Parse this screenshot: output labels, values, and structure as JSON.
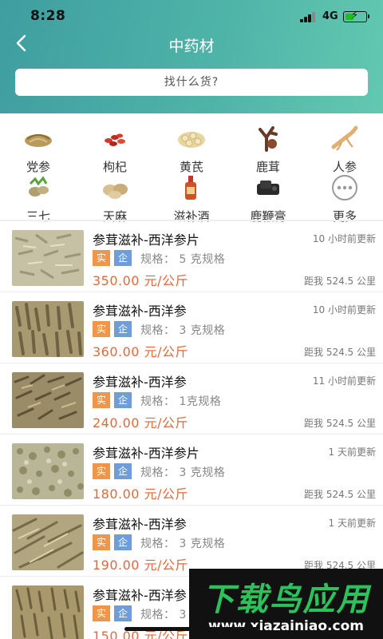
{
  "status_bar": {
    "time": "8:28",
    "network": "4G"
  },
  "nav": {
    "title": "中药材"
  },
  "search": {
    "placeholder": "找什么货?"
  },
  "categories": [
    {
      "label": "党参",
      "icon": "dangshen-icon"
    },
    {
      "label": "枸杞",
      "icon": "goji-icon"
    },
    {
      "label": "黄芪",
      "icon": "huangqi-icon"
    },
    {
      "label": "鹿茸",
      "icon": "antler-icon"
    },
    {
      "label": "人参",
      "icon": "ginseng-icon"
    },
    {
      "label": "三七",
      "icon": "sanqi-icon"
    },
    {
      "label": "天麻",
      "icon": "tianma-icon"
    },
    {
      "label": "滋补酒",
      "icon": "tonic-wine-icon"
    },
    {
      "label": "鹿鞭膏",
      "icon": "paste-icon"
    },
    {
      "label": "更多",
      "icon": "more-icon"
    }
  ],
  "listings": [
    {
      "title": "参茸滋补-西洋参片",
      "time": "10 小时前更新",
      "tag_shi": "实",
      "tag_qi": "企",
      "spec": "规格：  5 克规格",
      "price": "350.00 元/公斤",
      "distance": "距我 524.5 公里"
    },
    {
      "title": "参茸滋补-西洋参",
      "time": "10 小时前更新",
      "tag_shi": "实",
      "tag_qi": "企",
      "spec": "规格：  3 克规格",
      "price": "360.00 元/公斤",
      "distance": "距我 524.5 公里"
    },
    {
      "title": "参茸滋补-西洋参",
      "time": "11 小时前更新",
      "tag_shi": "实",
      "tag_qi": "企",
      "spec": "规格：  1克规格",
      "price": "240.00 元/公斤",
      "distance": "距我 524.5 公里"
    },
    {
      "title": "参茸滋补-西洋参片",
      "time": "1 天前更新",
      "tag_shi": "实",
      "tag_qi": "企",
      "spec": "规格：  3 克规格",
      "price": "180.00 元/公斤",
      "distance": "距我 524.5 公里"
    },
    {
      "title": "参茸滋补-西洋参",
      "time": "1 天前更新",
      "tag_shi": "实",
      "tag_qi": "企",
      "spec": "规格：  3 克规格",
      "price": "190.00 元/公斤",
      "distance": "距我 524.5 公里"
    },
    {
      "title": "参茸滋补-西洋参",
      "time": "",
      "tag_shi": "实",
      "tag_qi": "企",
      "spec": "规格：  3",
      "price": "150.00 元/公斤",
      "distance": ""
    }
  ],
  "watermark": {
    "main": "下载鸟应用",
    "url": "www.xiazainiao.com"
  },
  "colors": {
    "header_start": "#3f9ea0",
    "header_end": "#63c8b0",
    "price": "#e06a3a",
    "tag_shi": "#f0964a",
    "tag_qi": "#6f9ed6"
  }
}
